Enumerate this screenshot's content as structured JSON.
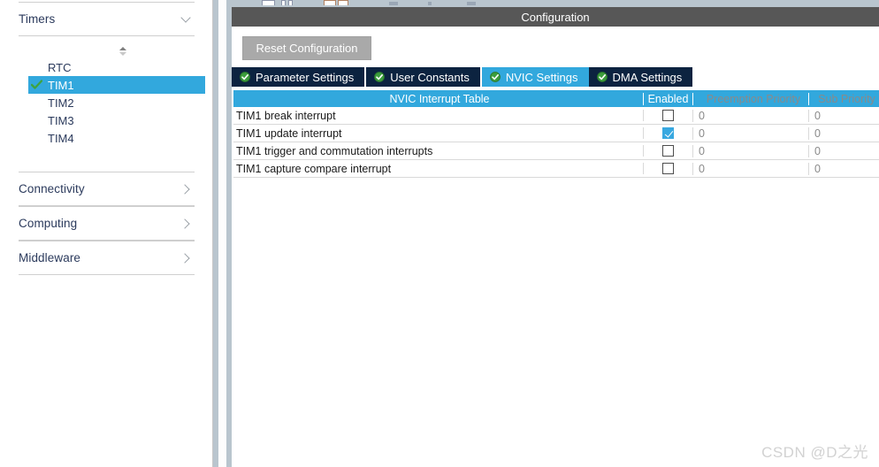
{
  "sidebar": {
    "sections": [
      {
        "label": "Timers",
        "icon": "chevron-down-icon",
        "expanded": true
      },
      {
        "label": "Connectivity",
        "icon": "chevron-right-icon",
        "expanded": false
      },
      {
        "label": "Computing",
        "icon": "chevron-right-icon",
        "expanded": false
      },
      {
        "label": "Middleware",
        "icon": "chevron-right-icon",
        "expanded": false
      }
    ],
    "scroll_icon": "scroll-up-indicator-icon",
    "peripherals": [
      {
        "label": "RTC",
        "selected": false,
        "configured": false
      },
      {
        "label": "TIM1",
        "selected": true,
        "configured": true
      },
      {
        "label": "TIM2",
        "selected": false,
        "configured": false
      },
      {
        "label": "TIM3",
        "selected": false,
        "configured": false
      },
      {
        "label": "TIM4",
        "selected": false,
        "configured": false
      }
    ]
  },
  "panel": {
    "title": "Configuration",
    "reset_button": "Reset Configuration",
    "tabs": [
      {
        "label": "Parameter Settings",
        "icon": "green-check-icon",
        "active": false
      },
      {
        "label": "User Constants",
        "icon": "green-check-icon",
        "active": false
      },
      {
        "label": "NVIC Settings",
        "icon": "green-check-icon",
        "active": true
      },
      {
        "label": "DMA Settings",
        "icon": "green-check-icon",
        "active": false
      }
    ],
    "table": {
      "headers": [
        "NVIC Interrupt Table",
        "Enabled",
        "Preemption Priority",
        "Sub Priority"
      ],
      "rows": [
        {
          "name": "TIM1 break interrupt",
          "enabled": false,
          "preemption": "0",
          "sub": "0"
        },
        {
          "name": "TIM1 update interrupt",
          "enabled": true,
          "preemption": "0",
          "sub": "0"
        },
        {
          "name": "TIM1 trigger and commutation interrupts",
          "enabled": false,
          "preemption": "0",
          "sub": "0"
        },
        {
          "name": "TIM1 capture compare interrupt",
          "enabled": false,
          "preemption": "0",
          "sub": "0"
        }
      ]
    }
  },
  "watermark": "CSDN @D之光",
  "colors": {
    "accent_blue": "#32a8dd",
    "tab_dark": "#0c2340",
    "header_gray": "#575757",
    "check_green": "#4fa84f",
    "panel_gap": "#b9c5ce"
  }
}
